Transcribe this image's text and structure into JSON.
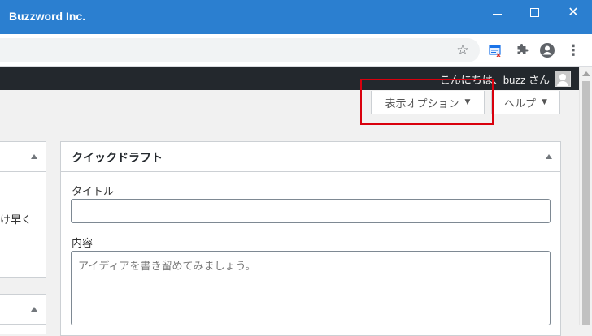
{
  "window": {
    "title": "Buzzword Inc.",
    "close_glyph": "✕"
  },
  "browser": {
    "icons": [
      "star-icon",
      "extension-icon",
      "puzzle-icon",
      "profile-icon",
      "menu-icon"
    ],
    "star_glyph": "☆",
    "kebab_glyph": "⋮"
  },
  "adminbar": {
    "greeting": "こんにちは、buzz さん"
  },
  "screen_meta": {
    "display_options_label": "表示オプション",
    "help_label": "ヘルプ",
    "arrow_glyph": "▼"
  },
  "left_panel": {
    "partial_text": "け早く"
  },
  "quick_draft": {
    "title": "クイックドラフト",
    "title_label": "タイトル",
    "title_value": "",
    "content_label": "内容",
    "content_placeholder": "アイディアを書き留めてみましょう。"
  },
  "colors": {
    "titlebar": "#2b7fd0",
    "adminbar": "#23282d",
    "highlight": "#d9000d"
  }
}
